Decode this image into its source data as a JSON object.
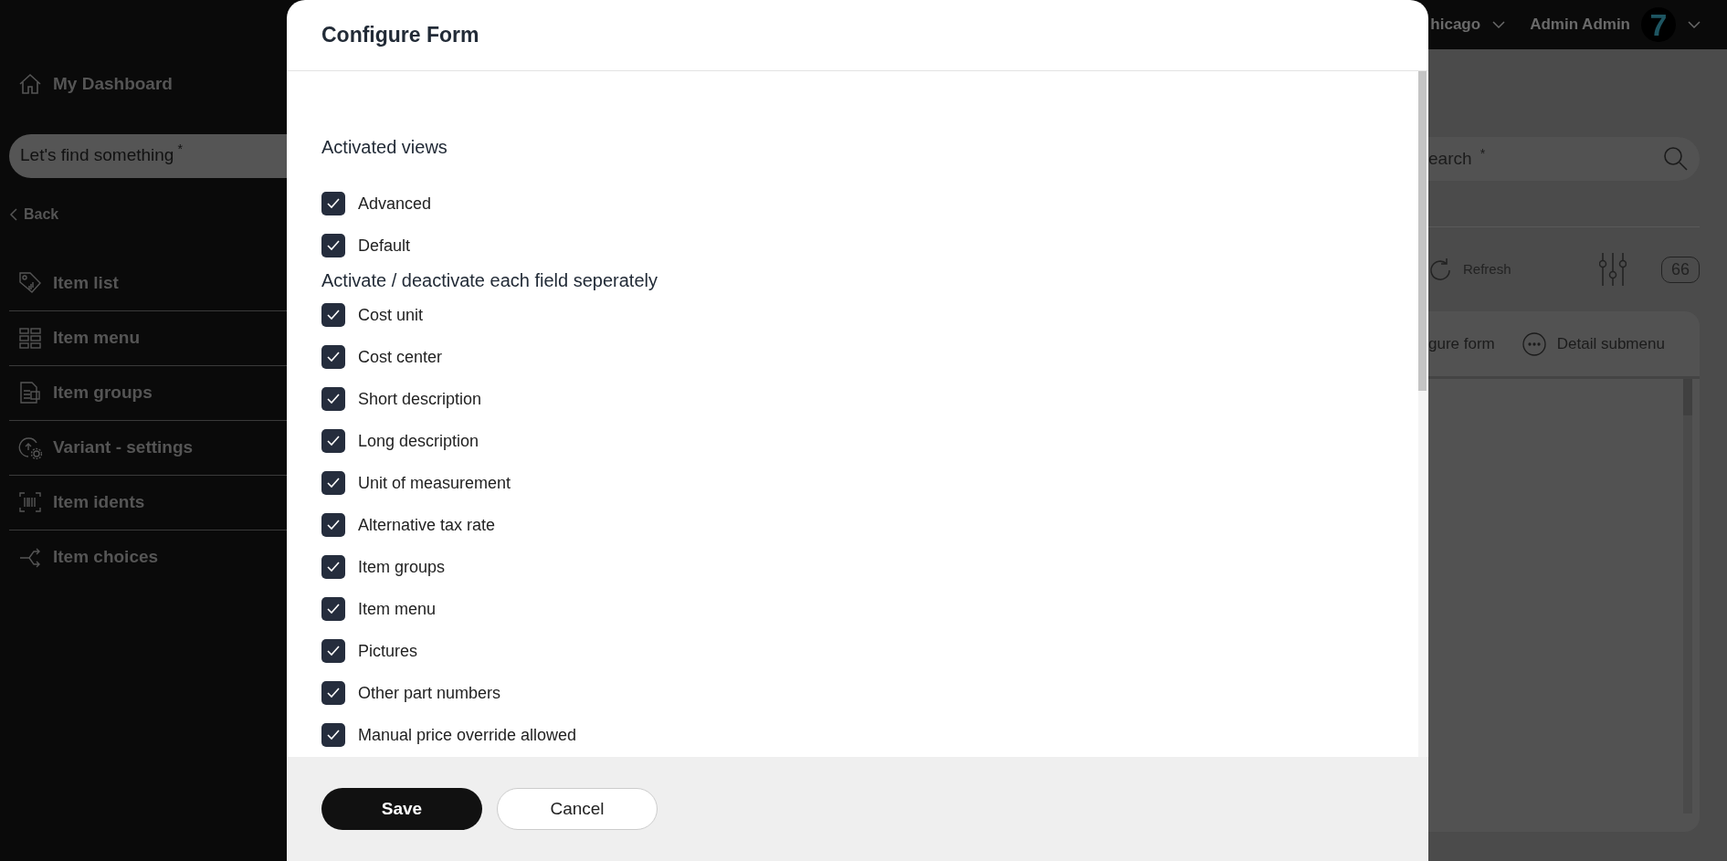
{
  "topbar": {
    "location": "hicago",
    "user": "Admin Admin",
    "avatar": "7"
  },
  "sidebar": {
    "dashboard": "My Dashboard",
    "search": "Let's find something $^{*}$",
    "back": "Back",
    "items": [
      {
        "label": "Item list"
      },
      {
        "label": "Item menu"
      },
      {
        "label": "Item groups"
      },
      {
        "label": "Variant - settings"
      },
      {
        "label": "Item idents"
      },
      {
        "label": "Item choices"
      }
    ]
  },
  "main": {
    "search": "earch $^{*}$",
    "refresh": "Refresh",
    "count": "66",
    "configure": "gure form",
    "detail": "Detail submenu"
  },
  "modal": {
    "title": "Configure Form",
    "sections": [
      {
        "heading": "Activated views",
        "options": [
          {
            "label": "Advanced",
            "checked": true
          },
          {
            "label": "Default",
            "checked": true
          }
        ]
      },
      {
        "heading": "Activate / deactivate each field seperately",
        "options": [
          {
            "label": "Cost unit",
            "checked": true
          },
          {
            "label": "Cost center",
            "checked": true
          },
          {
            "label": "Short description",
            "checked": true
          },
          {
            "label": "Long description",
            "checked": true
          },
          {
            "label": "Unit of measurement",
            "checked": true
          },
          {
            "label": "Alternative tax rate",
            "checked": true
          },
          {
            "label": "Item groups",
            "checked": true
          },
          {
            "label": "Item menu",
            "checked": true
          },
          {
            "label": "Pictures",
            "checked": true
          },
          {
            "label": "Other part numbers",
            "checked": true
          },
          {
            "label": "Manual price override allowed",
            "checked": true
          }
        ]
      }
    ],
    "buttons": [
      {
        "label": "Save",
        "kind": "primary"
      },
      {
        "label": "Cancel",
        "kind": "secondary"
      }
    ]
  }
}
